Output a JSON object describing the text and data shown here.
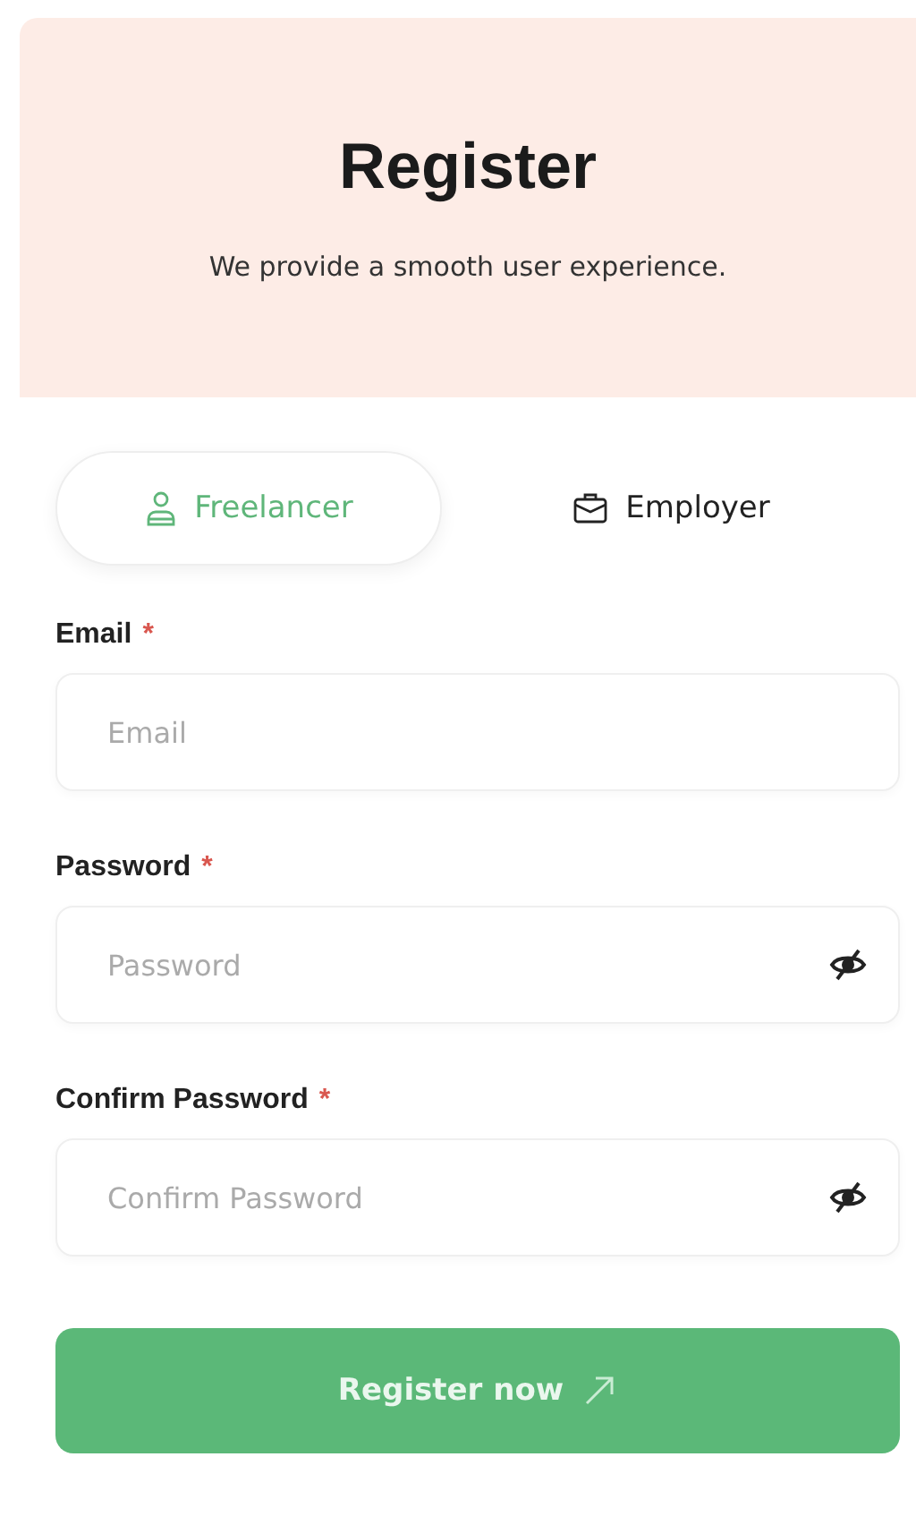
{
  "header": {
    "title": "Register",
    "subtitle": "We provide a smooth user experience."
  },
  "tabs": [
    {
      "label": "Freelancer",
      "selected": true
    },
    {
      "label": "Employer",
      "selected": false
    }
  ],
  "fields": [
    {
      "label": "Email",
      "required_mark": "*",
      "placeholder": "Email",
      "kind": "text"
    },
    {
      "label": "Password",
      "required_mark": "*",
      "placeholder": "Password",
      "kind": "password"
    },
    {
      "label": "Confirm Password",
      "required_mark": "*",
      "placeholder": "Confirm Password",
      "kind": "password"
    }
  ],
  "submit": {
    "label": "Register now"
  }
}
